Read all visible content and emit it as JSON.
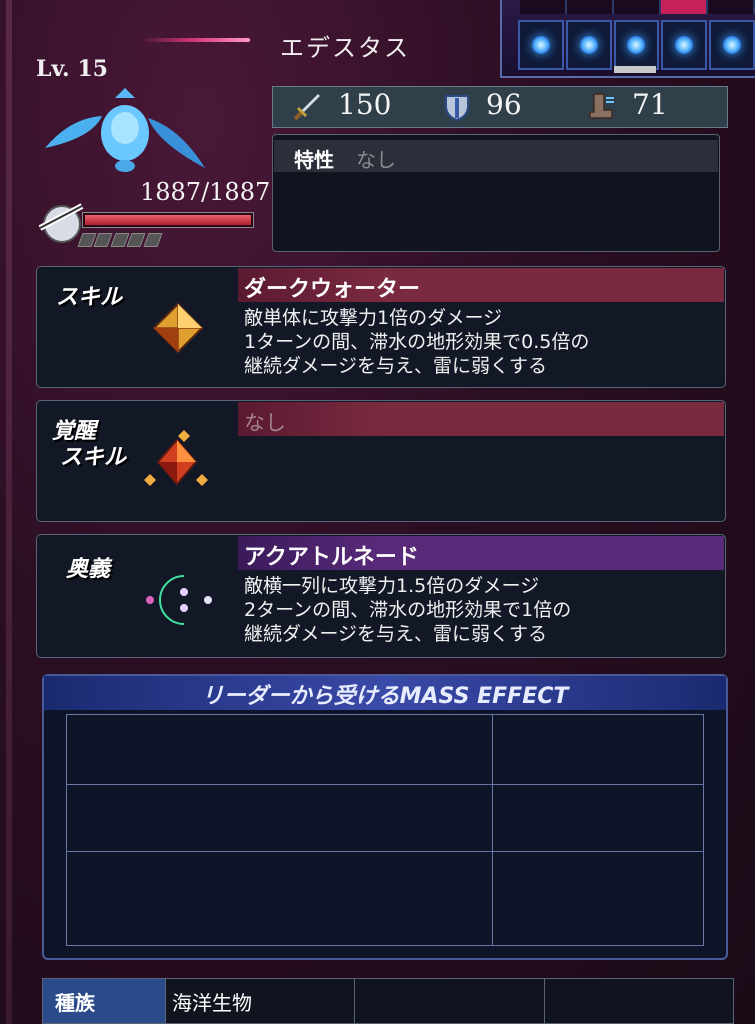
{
  "unit": {
    "name": "エデスタス",
    "level": "Lv. 15",
    "hp": "1887/1887",
    "hp_fraction": 1.0
  },
  "party": {
    "slots": 5,
    "selected_top_tab": 5
  },
  "stats": {
    "attack": "150",
    "defense": "96",
    "move": "71"
  },
  "trait": {
    "label": "特性",
    "value": "なし"
  },
  "skill": {
    "category": "スキル",
    "name": "ダークウォーター",
    "description": "敵単体に攻撃力1倍のダメージ\n1ターンの間、滞水の地形効果で0.5倍の\n継続ダメージを与え、雷に弱くする"
  },
  "awakened_skill": {
    "category_line1": "覚醒",
    "category_line2": "スキル",
    "name": "なし"
  },
  "ougi": {
    "category": "奥義",
    "name": "アクアトルネード",
    "description": "敵横一列に攻撃力1.5倍のダメージ\n2ターンの間、滞水の地形効果で1倍の\n継続ダメージを与え、雷に弱くする"
  },
  "mass_effect": {
    "title": "リーダーから受けるMASS EFFECT"
  },
  "race": {
    "label": "種族",
    "value": "海洋生物",
    "extra1": "",
    "extra2": ""
  },
  "colors": {
    "skill_header": "#7a2a40",
    "ougi_header": "#5a2a7a",
    "mass_header": "#3a4aa8",
    "hp_fill": "#d03040"
  },
  "icons": [
    "sword-icon",
    "shield-icon",
    "boot-icon",
    "hp-shield-icon",
    "skill-gem-icon",
    "awakened-gem-icon",
    "ougi-orb-icon"
  ]
}
